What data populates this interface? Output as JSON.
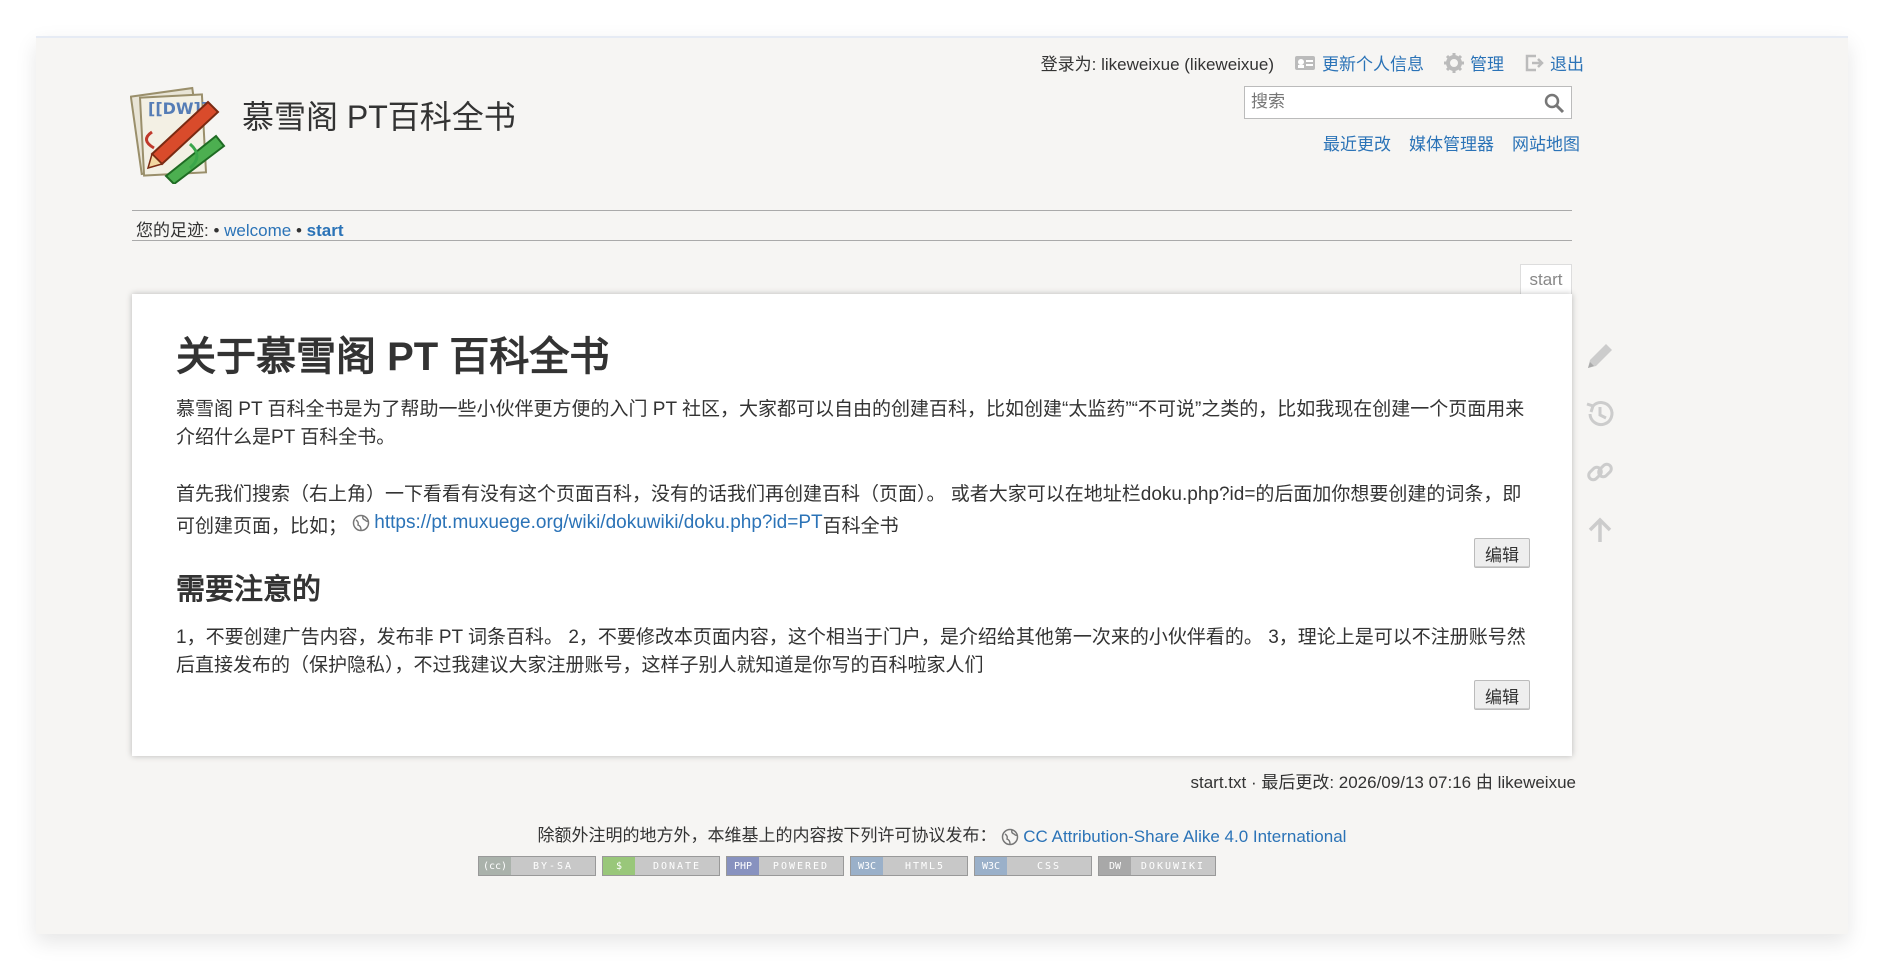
{
  "header": {
    "site_title": "慕雪阁 PT百科全书",
    "logo_text": "[[DW]]",
    "user_label": "登录为: likeweixue (likeweixue)",
    "user_tools": [
      "更新个人信息",
      "管理",
      "退出"
    ],
    "search_placeholder": "搜索",
    "site_tools": [
      "最近更改",
      "媒体管理器",
      "网站地图"
    ]
  },
  "breadcrumbs": {
    "label": "您的足迹:",
    "items": [
      "welcome",
      "start"
    ]
  },
  "page": {
    "page_id": "start",
    "h1": "关于慕雪阁 PT 百科全书",
    "p1": "慕雪阁 PT 百科全书是为了帮助一些小伙伴更方便的入门 PT 社区，大家都可以自由的创建百科，比如创建“太监药”“不可说”之类的，比如我现在创建一个页面用来介绍什么是PT 百科全书。",
    "p2_text": "首先我们搜索（右上角）一下看看有没有这个页面百科，没有的话我们再创建百科（页面）。 或者大家可以在地址栏doku.php?id=的后面加你想要创建的词条，即可创建页面，比如；",
    "p2_link": "https://pt.muxuege.org/wiki/dokuwiki/doku.php?id=PT",
    "p2_suffix": "百科全书",
    "h2": "需要注意的",
    "p3": "1，不要创建广告内容，发布非 PT 词条百科。 2，不要修改本页面内容，这个相当于门户，是介绍给其他第一次来的小伙伴看的。 3，理论上是可以不注册账号然后直接发布的（保护隐私），不过我建议大家注册账号，这样子别人就知道是你写的百科啦家人们",
    "edit_label": "编辑"
  },
  "page_tools": [
    "pencil-icon",
    "history-icon",
    "link-icon",
    "arrow-up-icon"
  ],
  "footer": {
    "docinfo": "start.txt · 最后更改: 2026/09/13 07:16 由 likeweixue",
    "license_text": "除额外注明的地方外，本维基上的内容按下列许可协议发布：",
    "license_link": "CC Attribution-Share Alike 4.0 International",
    "badges": [
      {
        "lead": "(cc)",
        "label": "BY-SA",
        "color": "#aab2ab"
      },
      {
        "lead": "$",
        "label": "DONATE",
        "color": "#99c77a"
      },
      {
        "lead": "PHP",
        "label": "POWERED",
        "color": "#8892bf"
      },
      {
        "lead": "W3C",
        "label": "HTML5",
        "color": "#9ab0c9"
      },
      {
        "lead": "W3C",
        "label": "CSS",
        "color": "#9ab0c9"
      },
      {
        "lead": "DW",
        "label": "DOKUWIKI",
        "color": "#a8a8a8"
      }
    ]
  },
  "colors": {
    "link": "#2b73b7",
    "frame_bg": "#f6f5f3",
    "text": "#333333"
  }
}
